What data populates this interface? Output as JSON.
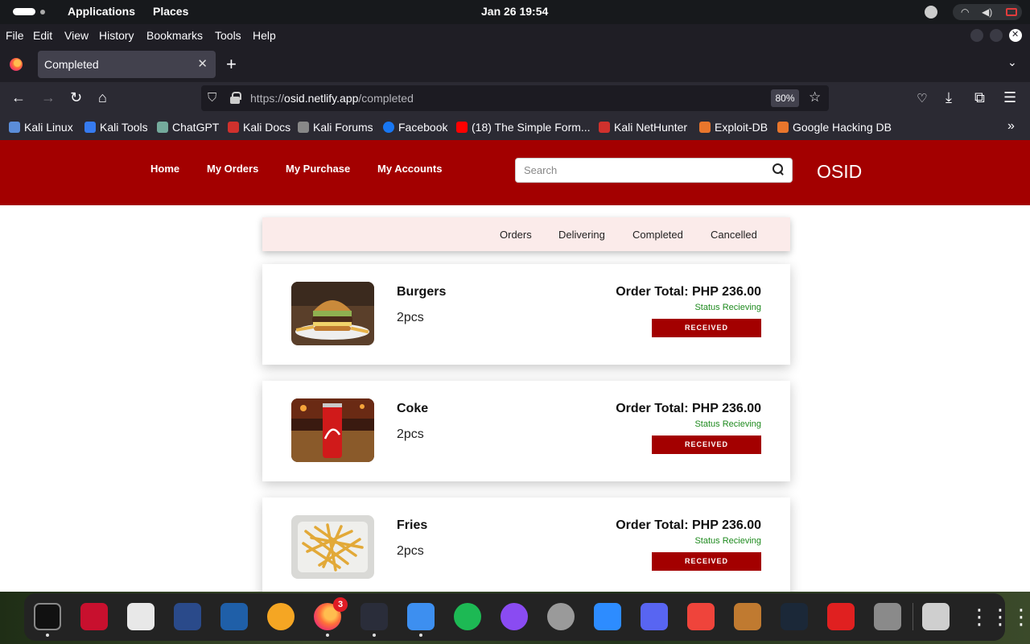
{
  "system_bar": {
    "applications": "Applications",
    "places": "Places",
    "clock": "Jan 26  19:54"
  },
  "menu": [
    "File",
    "Edit",
    "View",
    "History",
    "Bookmarks",
    "Tools",
    "Help"
  ],
  "tab": {
    "title": "Completed",
    "close": "✕",
    "new_tab": "+"
  },
  "url": {
    "scheme": "https://",
    "host": "osid.netlify.app",
    "path": "/completed",
    "zoom": "80%"
  },
  "bookmarks": [
    {
      "label": "Kali Linux",
      "color": "#5b8dd9"
    },
    {
      "label": "Kali Tools",
      "color": "#367bf0"
    },
    {
      "label": "ChatGPT",
      "color": "#74aa9c"
    },
    {
      "label": "Kali Docs",
      "color": "#d0312d"
    },
    {
      "label": "Kali Forums",
      "color": "#888888"
    },
    {
      "label": "Facebook",
      "color": "#1877f2"
    },
    {
      "label": "(18) The Simple Form...",
      "color": "#ff0000"
    },
    {
      "label": "Kali NetHunter",
      "color": "#d0312d"
    },
    {
      "label": "Exploit-DB",
      "color": "#e8762c"
    },
    {
      "label": "Google Hacking DB",
      "color": "#e8762c"
    }
  ],
  "site": {
    "nav": [
      "Home",
      "My Orders",
      "My Purchase",
      "My Accounts"
    ],
    "search_placeholder": "Search",
    "brand": "OSID",
    "filters": [
      "Orders",
      "Delivering",
      "Completed",
      "Cancelled"
    ],
    "orders": [
      {
        "name": "Burgers",
        "qty": "2pcs",
        "total": "Order Total: PHP 236.00",
        "status": "Status Recieving",
        "button": "RECEIVED"
      },
      {
        "name": "Coke",
        "qty": "2pcs",
        "total": "Order Total: PHP 236.00",
        "status": "Status Recieving",
        "button": "RECEIVED"
      },
      {
        "name": "Fries",
        "qty": "2pcs",
        "total": "Order Total: PHP 236.00",
        "status": "Status Recieving",
        "button": "RECEIVED"
      }
    ]
  },
  "dock": {
    "firefox_badge": "3",
    "apps": [
      "terminal",
      "root-terminal",
      "text-editor",
      "metasploit",
      "wireshark",
      "burpsuite",
      "firefox",
      "vscode",
      "finder",
      "spotify",
      "messenger",
      "settings",
      "zoom",
      "discord",
      "anydesk",
      "game",
      "steam",
      "acrobat",
      "sound",
      "trash",
      "app-grid"
    ]
  },
  "colors": {
    "brand_red": "#a30000",
    "status_green": "#1e8a1e",
    "filter_bg": "#fbebea"
  }
}
